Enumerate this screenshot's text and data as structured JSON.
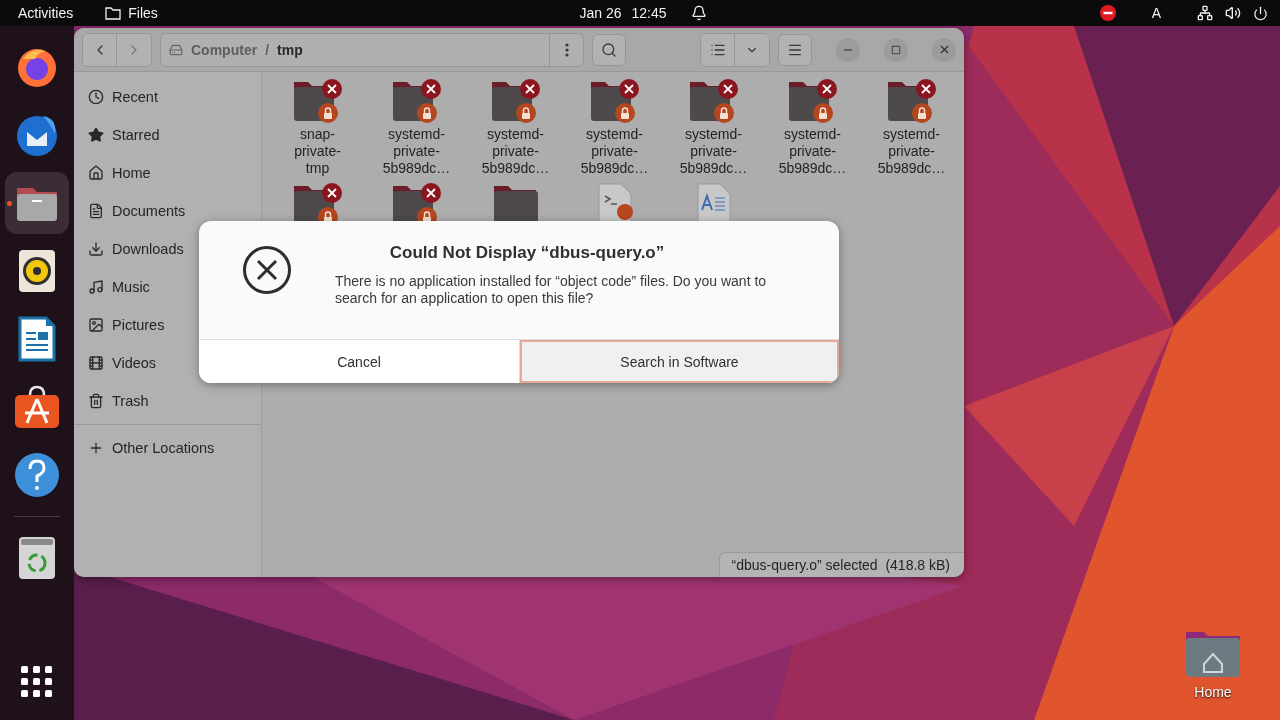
{
  "top_bar": {
    "activities": "Activities",
    "app": "Files",
    "date": "Jan 26",
    "time": "12:45",
    "keyboard": "A"
  },
  "dock": {
    "apps": [
      {
        "kind": "firefox",
        "active": false
      },
      {
        "kind": "thunderbird",
        "active": false
      },
      {
        "kind": "files",
        "active": true
      },
      {
        "kind": "rhythmbox",
        "active": false
      },
      {
        "kind": "writer",
        "active": false
      },
      {
        "kind": "software",
        "active": false
      },
      {
        "kind": "help",
        "active": false
      }
    ],
    "pinned_after_separator": [
      {
        "kind": "trash",
        "active": false
      }
    ]
  },
  "window": {
    "path": [
      {
        "label": "Computer",
        "current": false
      },
      {
        "label": "/",
        "current": false
      },
      {
        "label": "tmp",
        "current": true
      }
    ],
    "sidebar": {
      "items": [
        {
          "kind": "recent",
          "label": "Recent",
          "selected": false
        },
        {
          "kind": "starred",
          "label": "Starred",
          "selected": false
        },
        {
          "kind": "home",
          "label": "Home",
          "selected": false
        },
        {
          "kind": "documents",
          "label": "Documents",
          "selected": false
        },
        {
          "kind": "downloads",
          "label": "Downloads",
          "selected": false
        },
        {
          "kind": "music",
          "label": "Music",
          "selected": false
        },
        {
          "kind": "pictures",
          "label": "Pictures",
          "selected": false
        },
        {
          "kind": "videos",
          "label": "Videos",
          "selected": false
        },
        {
          "kind": "trash",
          "label": "Trash",
          "selected": false
        }
      ],
      "other_locations": "Other Locations"
    },
    "files": [
      {
        "kind": "locked-folder",
        "name_lines": [
          "snap-",
          "private-",
          "tmp"
        ]
      },
      {
        "kind": "locked-folder",
        "name_lines": [
          "systemd-",
          "private-",
          "5b989dc…"
        ]
      },
      {
        "kind": "locked-folder",
        "name_lines": [
          "systemd-",
          "private-",
          "5b989dc…"
        ]
      },
      {
        "kind": "locked-folder",
        "name_lines": [
          "systemd-",
          "private-",
          "5b989dc…"
        ]
      },
      {
        "kind": "locked-folder",
        "name_lines": [
          "systemd-",
          "private-",
          "5b989dc…"
        ]
      },
      {
        "kind": "locked-folder",
        "name_lines": [
          "systemd-",
          "private-",
          "5b989dc…"
        ]
      },
      {
        "kind": "locked-folder",
        "name_lines": [
          "systemd-",
          "private-",
          "5b989dc…"
        ]
      },
      {
        "kind": "locked-folder"
      },
      {
        "kind": "locked-folder"
      },
      {
        "kind": "folder"
      },
      {
        "kind": "script"
      },
      {
        "kind": "text"
      }
    ],
    "status": "“dbus-query.o” selected  (418.8 kB)"
  },
  "dialog": {
    "title": "Could Not Display “dbus-query.o”",
    "message": "There is no application installed for “object code” files. Do you want to search for an application to open this file?",
    "buttons": [
      {
        "label": "Cancel",
        "focused": false
      },
      {
        "label": "Search in Software",
        "focused": true
      }
    ]
  },
  "desktop_icons": [
    {
      "label": "Home"
    }
  ]
}
